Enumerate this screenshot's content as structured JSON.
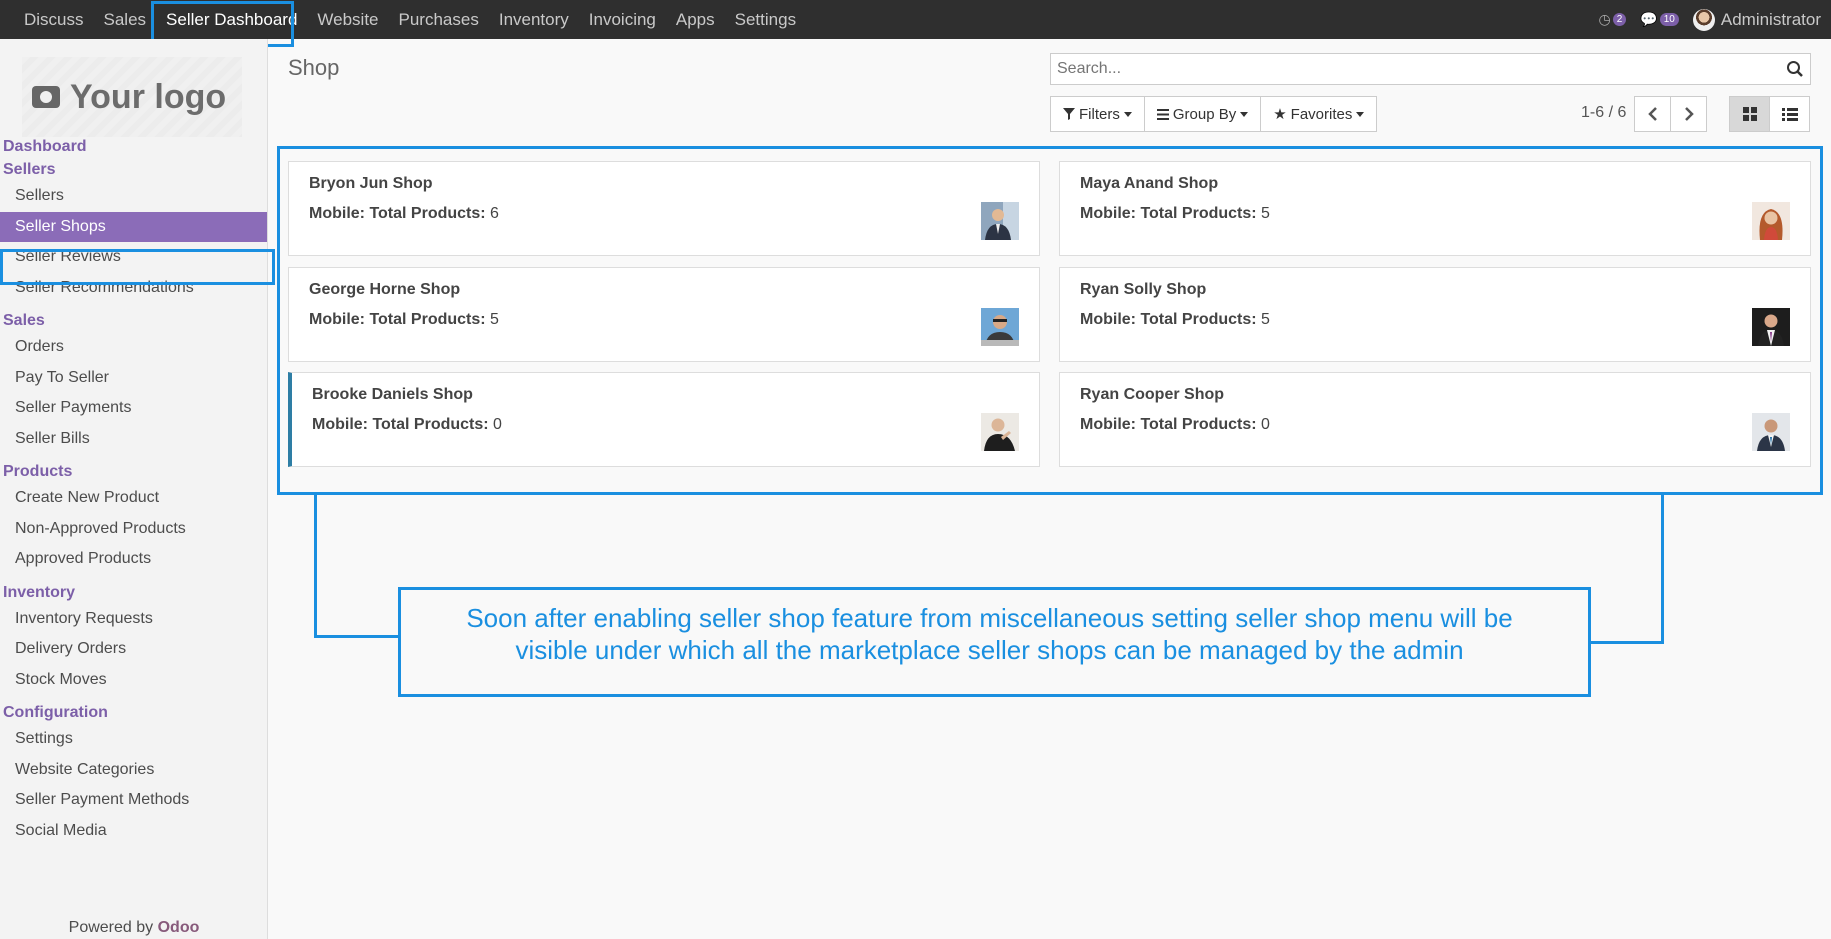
{
  "topbar": {
    "menus": [
      "Discuss",
      "Sales",
      "Seller Dashboard",
      "Website",
      "Purchases",
      "Inventory",
      "Invoicing",
      "Apps",
      "Settings"
    ],
    "active_menu": "Seller Dashboard",
    "activity_count": "2",
    "message_count": "10",
    "user_name": "Administrator"
  },
  "sidebar": {
    "logo_text": "Your logo",
    "sections": [
      {
        "title": "Dashboard",
        "items": []
      },
      {
        "title": "Sellers",
        "items": [
          "Sellers",
          "Seller Shops",
          "Seller Reviews",
          "Seller Recommendations"
        ]
      },
      {
        "title": "Sales",
        "items": [
          "Orders",
          "Pay To Seller",
          "Seller Payments",
          "Seller Bills"
        ]
      },
      {
        "title": "Products",
        "items": [
          "Create New Product",
          "Non-Approved Products",
          "Approved Products"
        ]
      },
      {
        "title": "Inventory",
        "items": [
          "Inventory Requests",
          "Delivery Orders",
          "Stock Moves"
        ]
      },
      {
        "title": "Configuration",
        "items": [
          "Settings",
          "Website Categories",
          "Seller Payment Methods",
          "Social Media"
        ]
      }
    ],
    "active_item": "Seller Shops",
    "powered_prefix": "Powered by",
    "powered_brand": "Odoo"
  },
  "control": {
    "title": "Shop",
    "search_placeholder": "Search...",
    "filters_label": "Filters",
    "groupby_label": "Group By",
    "favorites_label": "Favorites",
    "pager": "1-6 / 6"
  },
  "cards": [
    {
      "name": "Bryon Jun Shop",
      "label": "Mobile: Total Products:",
      "value": "6"
    },
    {
      "name": "Maya Anand Shop",
      "label": "Mobile: Total Products:",
      "value": "5"
    },
    {
      "name": "George Horne Shop",
      "label": "Mobile: Total Products:",
      "value": "5"
    },
    {
      "name": "Ryan Solly Shop",
      "label": "Mobile: Total Products:",
      "value": "5"
    },
    {
      "name": "Brooke Daniels Shop",
      "label": "Mobile: Total Products:",
      "value": "0"
    },
    {
      "name": "Ryan Cooper Shop",
      "label": "Mobile: Total Products:",
      "value": "0"
    }
  ],
  "annotation": {
    "line1": "Soon after enabling seller shop feature from miscellaneous setting seller shop menu will be",
    "line2": "visible under which all the marketplace seller shops can be managed by the admin",
    "color": "#1a8fe0"
  },
  "colors": {
    "brand": "#7c5fa8",
    "active_item_bg": "#8b6cb8",
    "topbar_bg": "#2f2f2f"
  }
}
